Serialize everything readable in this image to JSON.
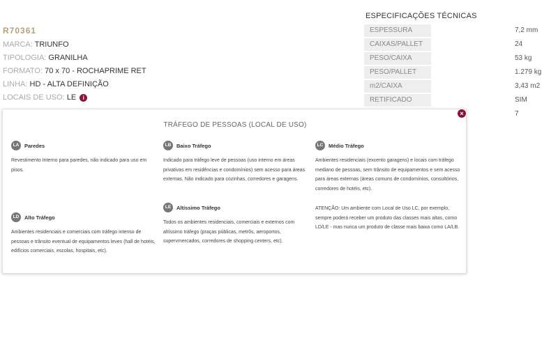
{
  "product": {
    "code": "R70361",
    "marca_key": "MARCA:",
    "marca_val": "TRIUNFO",
    "tipologia_key": "TIPOLOGIA:",
    "tipologia_val": "GRANILHA",
    "formato_key": "FORMATO:",
    "formato_val": "70 x 70 - ROCHAPRIME RET",
    "linha_key": "LINHA:",
    "linha_val": "HD - ALTA DEFINIÇÃO",
    "locais_key": "LOCAIS DE USO:",
    "locais_val": "LE",
    "info_icon": "i"
  },
  "specs": {
    "title": "ESPECIFICAÇÕES TÉCNICAS",
    "rows": [
      {
        "label": "ESPESSURA",
        "value": "7,2 mm"
      },
      {
        "label": "CAIXAS/PALLET",
        "value": "24"
      },
      {
        "label": "PESO/CAIXA",
        "value": "53 kg"
      },
      {
        "label": "PESO/PALLET",
        "value": "1.279 kg"
      },
      {
        "label": "m2/CAIXA",
        "value": "3,43 m2"
      },
      {
        "label": "RETIFICADO",
        "value": "SIM"
      },
      {
        "label": "",
        "value": "7"
      }
    ]
  },
  "panel": {
    "title": "TRÁFEGO DE PESSOAS (LOCAL DE USO)",
    "close_icon": "×",
    "classes": {
      "la": {
        "badge": "LA",
        "name": "Paredes",
        "desc": "Revestimento Interno para paredes, não indicado para uso em pisos."
      },
      "lb": {
        "badge": "LB",
        "name": "Baixo Tráfego",
        "desc": "Indicado para tráfego leve de pessoas (uso interno em áreas privativas em residências e condomínios) sem acesso para áreas externas. Não indicado para cozinhas, corredores e garagens."
      },
      "lc": {
        "badge": "LC",
        "name": "Médio Tráfego",
        "desc": "Ambientes residenciais (excento garagens) e locais com tráfego mediano de pessoas, sem trânsito de equipamentos e sem acesso para áreas externas (áreas comuns de condomínios, consultórios, corredores de hotéis, etc)."
      },
      "ld": {
        "badge": "LD",
        "name": "Alto Tráfego",
        "desc": "Ambientes residenciais e comerciais com tráfego intenso de pessoas e trânsito eventual de equipamentos leves (hall de hotéis, edifícios comerciais, escolas, hospitais, etc)."
      },
      "le": {
        "badge": "LE",
        "name": "Altíssimo Tráfego",
        "desc": "Todos os ambientes residenciais, comerciais e externos com altíssimo tráfego (praças públicas, metrôs, aeroportos, supervmercados, corredores de shopping centers, etc)."
      }
    },
    "attention": "ATENÇÃO: Um ambiente com Local de Uso LC, por exemplo, sempre poderá receber um produto das classes mais altas, como LD/LE - mas nunca um produto de classe mais baixa como LA/LB."
  }
}
